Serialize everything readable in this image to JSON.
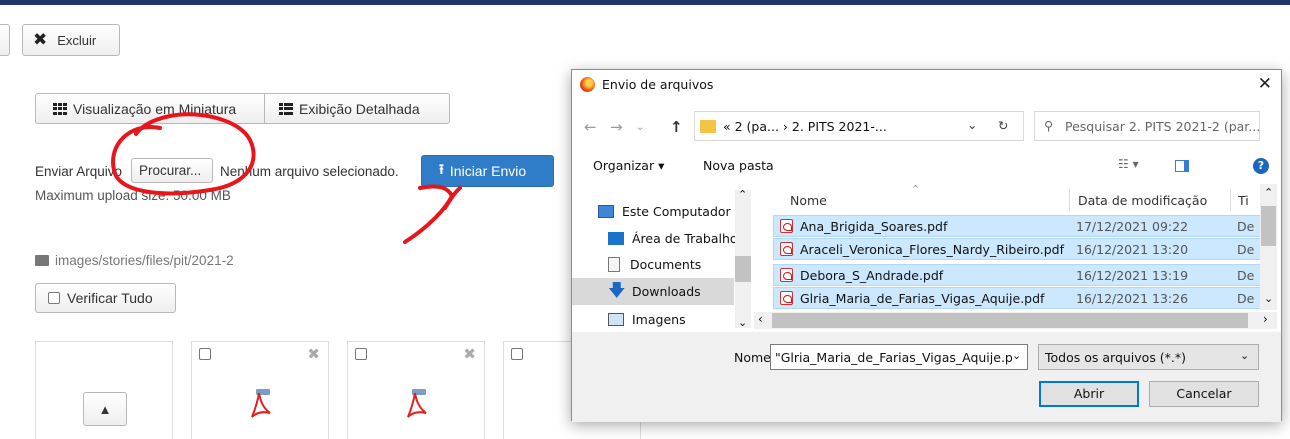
{
  "page": {
    "delete_label": "Excluir",
    "thumbnail_view_label": "Visualização em Miniatura",
    "detail_view_label": "Exibição Detalhada",
    "send_file_label": "Enviar Arquivo",
    "browse_label": "Procurar...",
    "no_file_label": "Nenhum arquivo selecionado.",
    "start_upload_label": "Iniciar Envio",
    "max_size_label": "Maximum upload size: 50.00 MB",
    "path": "images/stories/files/pit/2021-2",
    "check_all_label": "Verificar Tudo",
    "up_icon": "chevron-up-icon",
    "accent_color": "#2f7cc8",
    "annotation_color": "#e8151b"
  },
  "dialog": {
    "title": "Envio de arquivos",
    "address": "« 2 (pa...  ›  2. PITS 2021-...",
    "search_placeholder": "Pesquisar 2. PITS 2021-2 (par...",
    "organize_label": "Organizar ▾",
    "new_folder_label": "Nova pasta",
    "nav_items": [
      {
        "label": "Este Computador",
        "icon": "computer-icon"
      },
      {
        "label": "Área de Trabalho",
        "icon": "desktop-icon"
      },
      {
        "label": "Documents",
        "icon": "documents-icon"
      },
      {
        "label": "Downloads",
        "icon": "downloads-icon"
      },
      {
        "label": "Imagens",
        "icon": "images-icon"
      }
    ],
    "columns": {
      "name": "Nome",
      "date": "Data de modificação",
      "type": "Ti"
    },
    "files": [
      {
        "name": "Ana_Brigida_Soares.pdf",
        "date": "17/12/2021 09:22",
        "type": "De"
      },
      {
        "name": "Araceli_Veronica_Flores_Nardy_Ribeiro.pdf",
        "date": "16/12/2021 13:20",
        "type": "De"
      },
      {
        "name": "Debora_S_Andrade.pdf",
        "date": "16/12/2021 13:19",
        "type": "De"
      },
      {
        "name": "Glria_Maria_de_Farias_Vigas_Aquije.pdf",
        "date": "16/12/2021 13:26",
        "type": "De"
      }
    ],
    "filename_label": "Nome:",
    "filename_value": "\"Glria_Maria_de_Farias_Vigas_Aquije.p",
    "filter_value": "Todos os arquivos (*.*)",
    "open_label": "Abrir",
    "cancel_label": "Cancelar"
  }
}
